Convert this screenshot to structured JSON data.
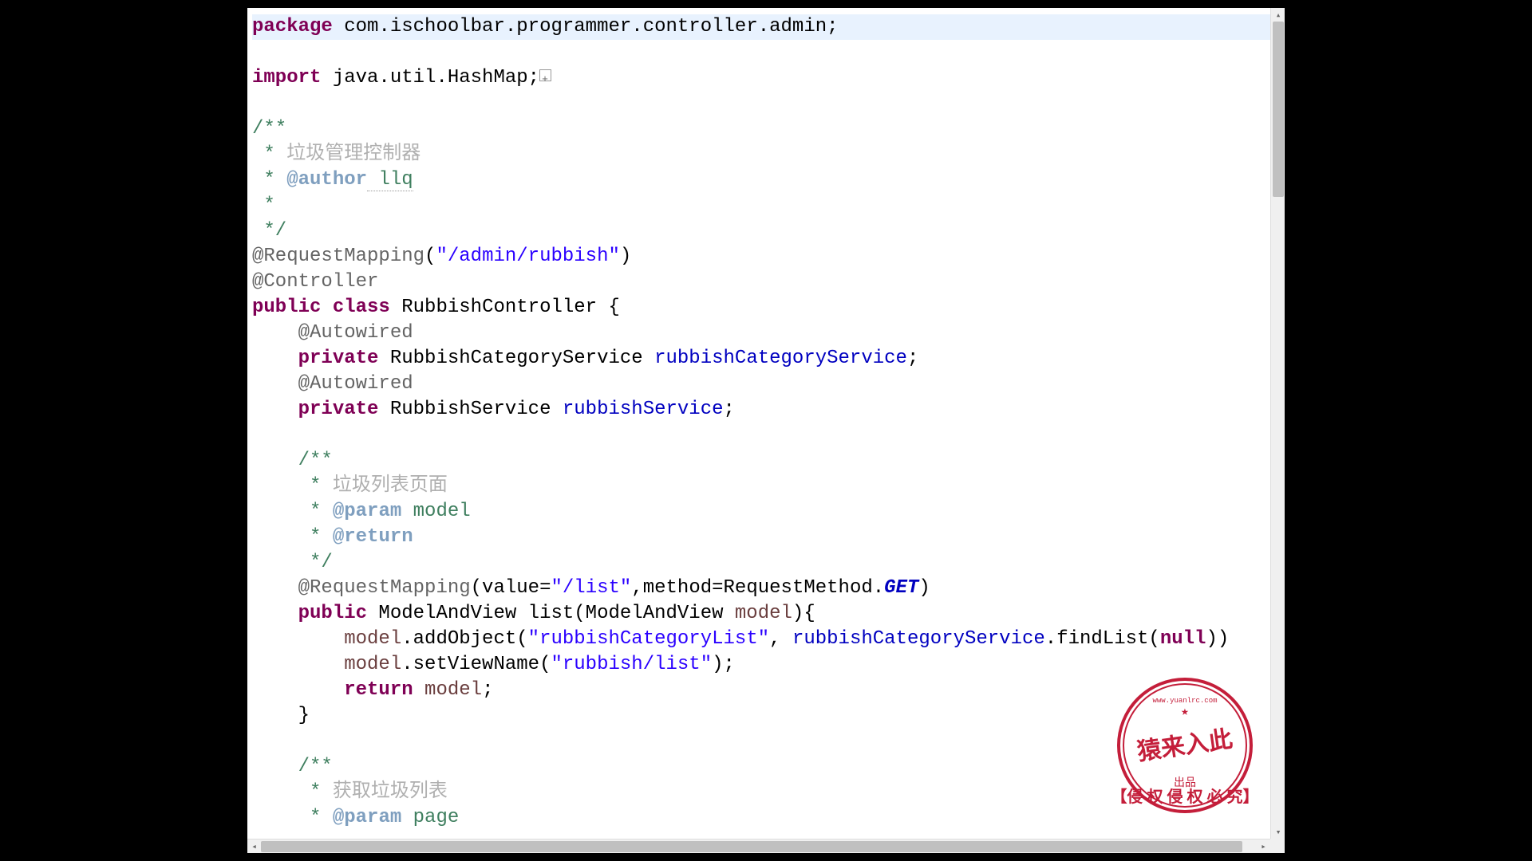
{
  "code": {
    "line1_kw": "package",
    "line1_rest": " com.ischoolbar.programmer.controller.admin;",
    "line3_kw": "import",
    "line3_rest": " java.util.HashMap;",
    "doc1_open": "/**",
    "doc1_star": " * ",
    "doc1_desc": "垃圾管理控制器",
    "doc1_author_tag": "@author",
    "doc1_author_name": " llq",
    "doc1_star_only": " *",
    "doc1_close": " */",
    "ann_reqmap": "@RequestMapping",
    "ann_reqmap_open": "(",
    "ann_reqmap_val": "\"/admin/rubbish\"",
    "ann_reqmap_close": ")",
    "ann_controller": "@Controller",
    "cls_public": "public",
    "cls_class": " class",
    "cls_name": " RubbishController {",
    "ann_autowired": "@Autowired",
    "fld1_private": "private",
    "fld1_type": " RubbishCategoryService ",
    "fld1_name": "rubbishCategoryService",
    "fld1_semi": ";",
    "fld2_private": "private",
    "fld2_type": " RubbishService ",
    "fld2_name": "rubbishService",
    "fld2_semi": ";",
    "m1_doc_open": "/**",
    "m1_doc_star": " * ",
    "m1_doc_desc": "垃圾列表页面",
    "m1_param_tag": "@param",
    "m1_param_name": " model",
    "m1_return_tag": "@return",
    "m1_doc_close": " */",
    "m1_ann": "@RequestMapping",
    "m1_ann_args1": "(value=",
    "m1_ann_val": "\"/list\"",
    "m1_ann_args2": ",method=RequestMethod.",
    "m1_ann_get": "GET",
    "m1_ann_args3": ")",
    "m1_sig_public": "public",
    "m1_sig_rest1": " ModelAndView list(ModelAndView ",
    "m1_sig_param": "model",
    "m1_sig_rest2": "){",
    "m1_body1_a": "model",
    "m1_body1_b": ".addObject(",
    "m1_body1_str": "\"rubbishCategoryList\"",
    "m1_body1_c": ", ",
    "m1_body1_d": "rubbishCategoryService",
    "m1_body1_e": ".findList(",
    "m1_body1_null": "null",
    "m1_body1_f": "))",
    "m1_body2_a": "model",
    "m1_body2_b": ".setViewName(",
    "m1_body2_str": "\"rubbish/list\"",
    "m1_body2_c": ");",
    "m1_return_kw": "return",
    "m1_return_rest": " ",
    "m1_return_var": "model",
    "m1_return_semi": ";",
    "m1_close": "}",
    "m2_doc_open": "/**",
    "m2_doc_star": " * ",
    "m2_doc_desc": "获取垃圾列表",
    "m2_param_tag": "@param",
    "m2_param_name": " page"
  },
  "stamp": {
    "url": "www.yuanlrc.com",
    "main1": "猿来入此",
    "sub": "出品",
    "bottom": "【侵 权 侵 权 必 究】"
  }
}
